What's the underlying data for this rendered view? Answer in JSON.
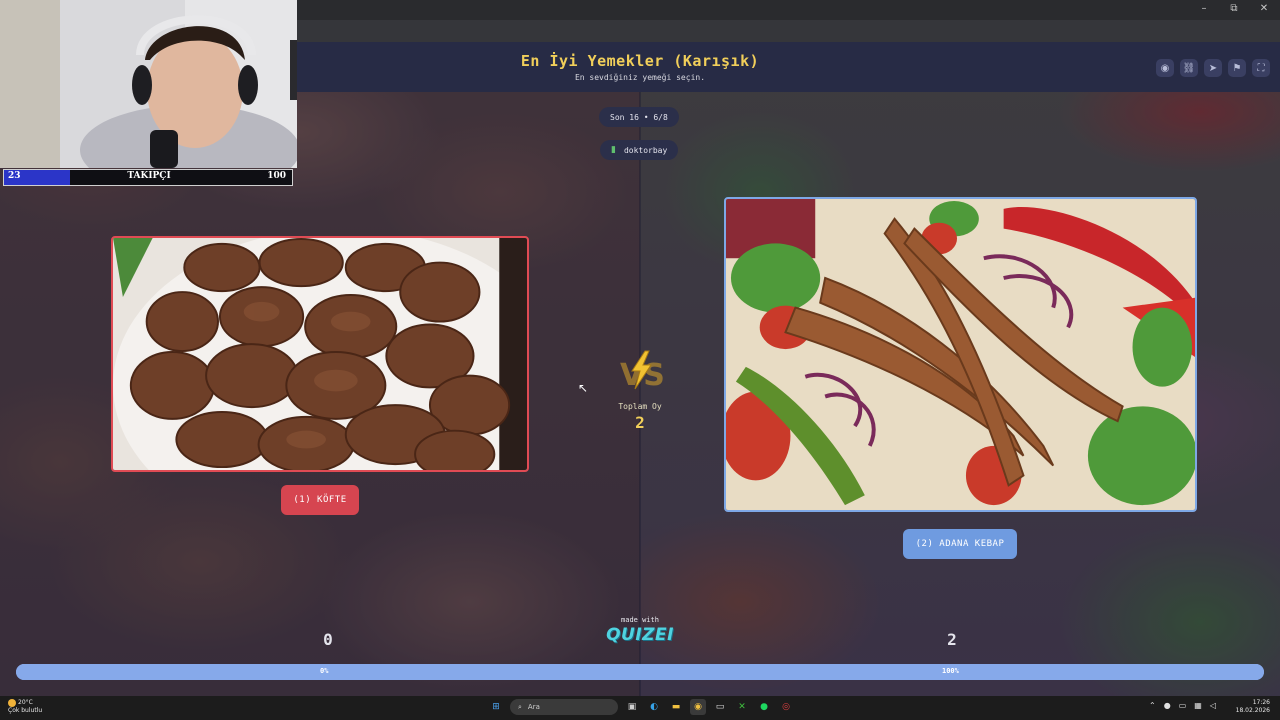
{
  "window": {
    "minimize": "–",
    "maximize": "⧉",
    "close": "✕"
  },
  "quiz": {
    "title": "En İyi Yemekler (Karışık)",
    "subtitle": "En sevdiğiniz yemeği seçin.",
    "round": "Son 16 • 6/8",
    "username": "doktorbay",
    "vs_label": "VS",
    "total_votes_label": "Toplam Oy",
    "total_votes": "2",
    "left_option": {
      "label": "(1) KÖFTE",
      "votes": "0",
      "percent": "0%",
      "share": 0
    },
    "right_option": {
      "label": "(2) ADANA KEBAP",
      "votes": "2",
      "percent": "100%",
      "share": 1
    },
    "made_with": "made with",
    "brand": "QUIZEI"
  },
  "stream": {
    "follower_current": "23",
    "follower_label": "TAKIPÇI",
    "follower_goal": "100",
    "follower_share": 0.23
  },
  "taskbar": {
    "temperature": "20°C",
    "weather": "Çok bulutlu",
    "search_placeholder": "Ara",
    "time": "17:26",
    "date": "18.02.2026"
  },
  "colors": {
    "title": "#f1cf5a",
    "left_accent": "#d64550",
    "right_accent": "#6f9be0",
    "brand": "#4fd3e0"
  }
}
